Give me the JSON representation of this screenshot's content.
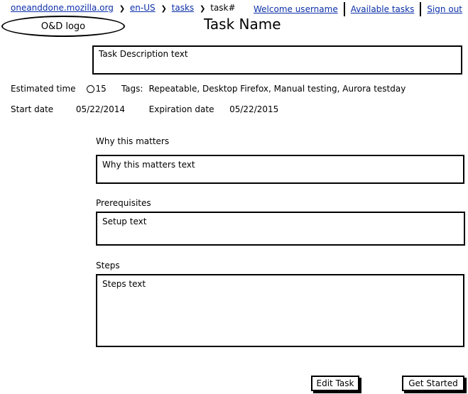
{
  "breadcrumb": {
    "home": "oneanddone.mozilla.org",
    "locale": "en-US",
    "tasks": "tasks",
    "current": "task#",
    "separator": "❯"
  },
  "user_nav": {
    "welcome": "Welcome username",
    "available_tasks": "Available tasks",
    "sign_out": "Sign out"
  },
  "logo": {
    "text": "O&D logo"
  },
  "task": {
    "title": "Task Name",
    "description": "Task Description text",
    "estimated_time_label": "Estimated time",
    "estimated_time_value": "15",
    "tags_label": "Tags:",
    "tags": "Repeatable, Desktop Firefox, Manual testing, Aurora testday",
    "start_date_label": "Start date",
    "start_date": "05/22/2014",
    "expiration_date_label": "Expiration date",
    "expiration_date": "05/22/2015"
  },
  "sections": {
    "why": {
      "label": "Why this matters",
      "text": "Why this matters text"
    },
    "prerequisites": {
      "label": "Prerequisites",
      "text": "Setup text"
    },
    "steps": {
      "label": "Steps",
      "text": "Steps text"
    }
  },
  "actions": {
    "edit_task": "Edit Task",
    "get_started": "Get Started"
  }
}
